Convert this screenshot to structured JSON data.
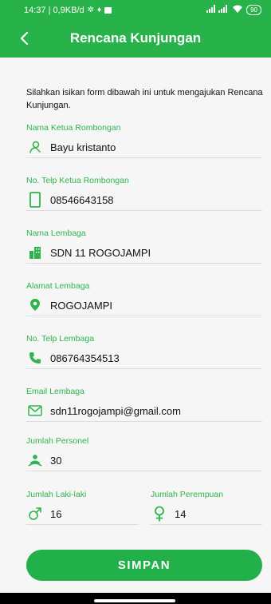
{
  "status_bar": {
    "left_text": "14:37 | 0,9KB/d",
    "battery": "90"
  },
  "header": {
    "title": "Rencana Kunjungan"
  },
  "form": {
    "intro": "Silahkan isikan form dibawah ini untuk mengajukan Rencana Kunjungan.",
    "fields": [
      {
        "label": "Nama Ketua Rombongan",
        "value": "Bayu kristanto",
        "icon": "person-icon"
      },
      {
        "label": "No. Telp Ketua Rombongan",
        "value": "08546643158",
        "icon": "phone-device-icon"
      },
      {
        "label": "Nama Lembaga",
        "value": "SDN 11 ROGOJAMPI",
        "icon": "building-icon"
      },
      {
        "label": "Alamat Lembaga",
        "value": "ROGOJAMPI",
        "icon": "location-icon"
      },
      {
        "label": "No. Telp Lembaga",
        "value": "086764354513",
        "icon": "phone-handset-icon"
      },
      {
        "label": "Email Lembaga",
        "value": "sdn11rogojampi@gmail.com",
        "icon": "mail-icon"
      },
      {
        "label": "Jumlah Personel",
        "value": "30",
        "icon": "group-icon"
      }
    ],
    "male": {
      "label": "Jumlah Laki-laki",
      "value": "16",
      "icon": "male-icon"
    },
    "female": {
      "label": "Jumlah Perempuan",
      "value": "14",
      "icon": "female-icon"
    },
    "submit_label": "SIMPAN"
  },
  "colors": {
    "primary": "#27b24a",
    "label": "#2db54d",
    "background": "#f6f6f6"
  }
}
